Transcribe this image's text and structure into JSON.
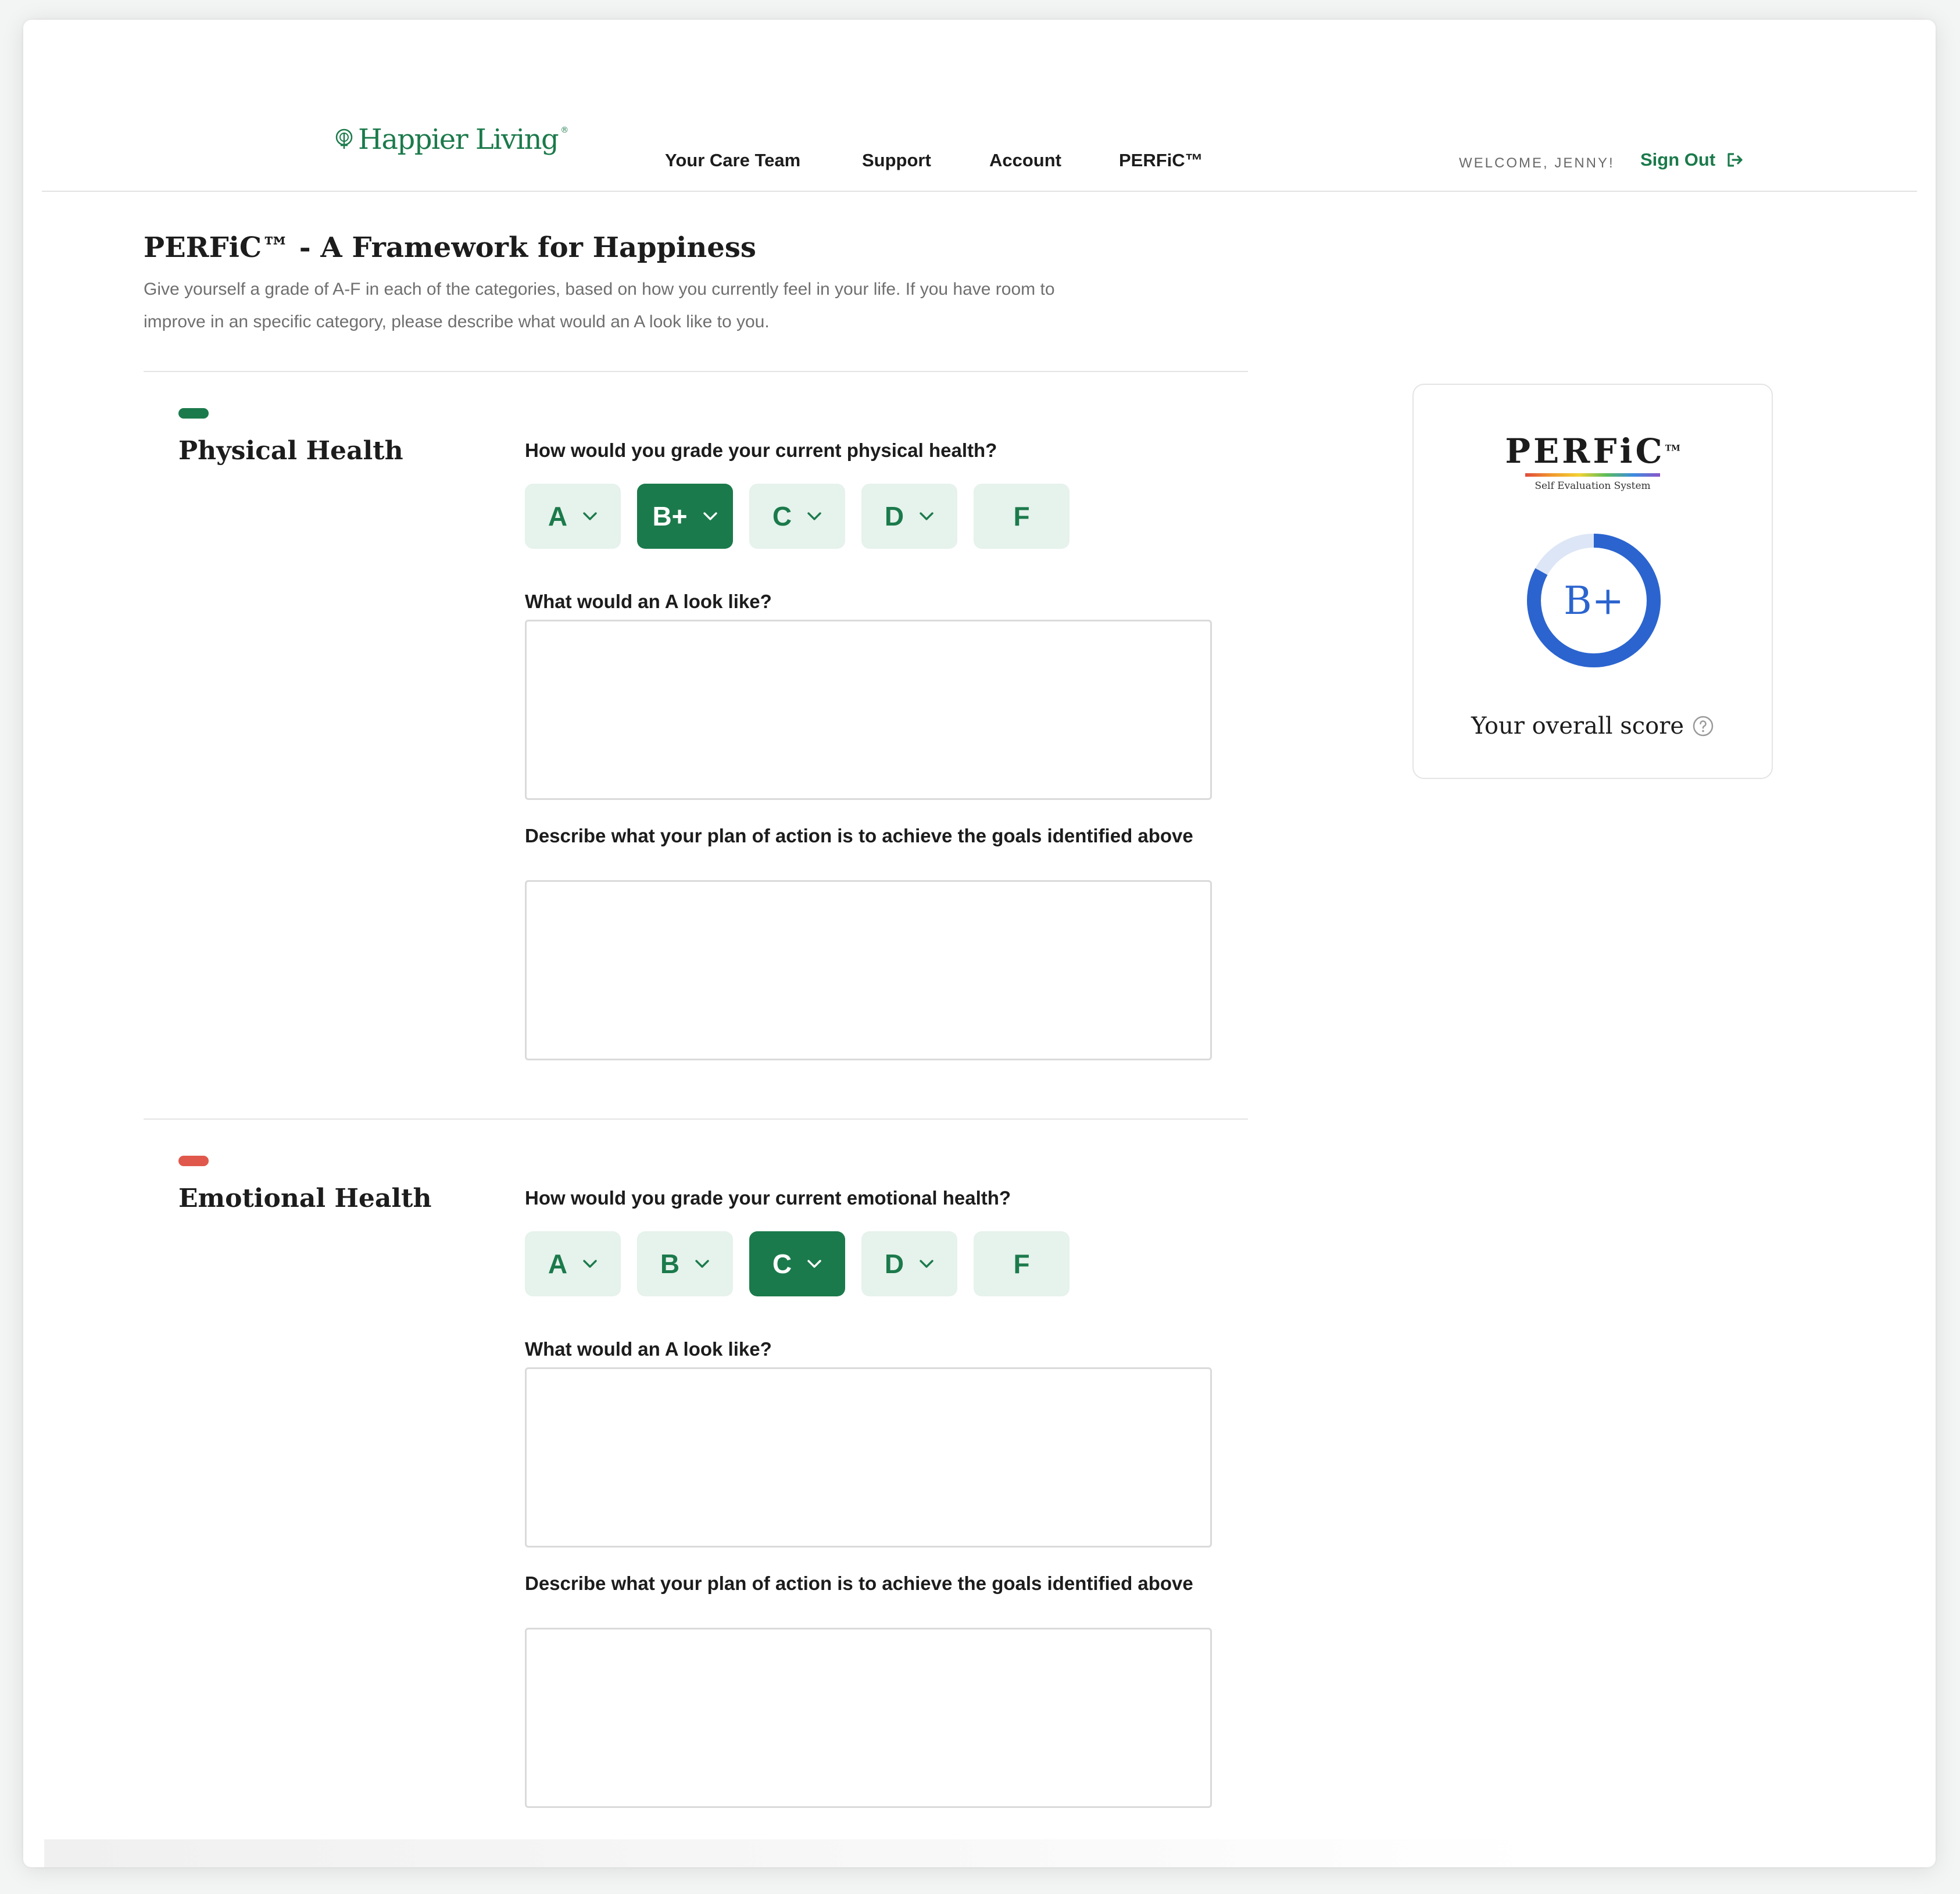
{
  "brand": {
    "name": "Happier Living",
    "logo_icon": "tree-icon",
    "color": "#1b7a4b"
  },
  "nav": {
    "items": [
      {
        "label": "Your Care Team"
      },
      {
        "label": "Support"
      },
      {
        "label": "Account"
      },
      {
        "label": "PERFiC™"
      }
    ],
    "welcome": "WELCOME, JENNY!",
    "sign_out": "Sign Out",
    "sign_out_icon": "sign-out-icon"
  },
  "page": {
    "title": "PERFiC™ - A Framework for Happiness",
    "description": "Give yourself a grade of A-F in each of the categories, based on how you currently feel in your life. If you have room to improve in an specific category, please describe what would an A look like to you."
  },
  "sections": [
    {
      "title": "Physical Health",
      "accent": "#1b7a4b",
      "question": "How would you grade your current physical health?",
      "grades": [
        "A",
        "B+",
        "C",
        "D",
        "F"
      ],
      "selected": "B+",
      "a_prompt": "What would an A look like?",
      "a_value": "",
      "plan_prompt": "Describe what your plan of action is to achieve the goals identified above",
      "plan_value": ""
    },
    {
      "title": "Emotional Health",
      "accent": "#e0584b",
      "question": "How would you grade your current emotional health?",
      "grades": [
        "A",
        "B",
        "C",
        "D",
        "F"
      ],
      "selected": "C",
      "a_prompt": "What would an A look like?",
      "a_value": "",
      "plan_prompt": "Describe what your plan of action is to achieve the goals identified above",
      "plan_value": ""
    }
  ],
  "score": {
    "logo_text": "PERFiC",
    "logo_tm": "TM",
    "logo_subtitle": "Self Evaluation System",
    "grade": "B+",
    "progress": 0.83,
    "ring_color": "#2b64cf",
    "track_color": "#dde6f6",
    "label": "Your overall score",
    "help_icon": "help-circle-icon"
  }
}
